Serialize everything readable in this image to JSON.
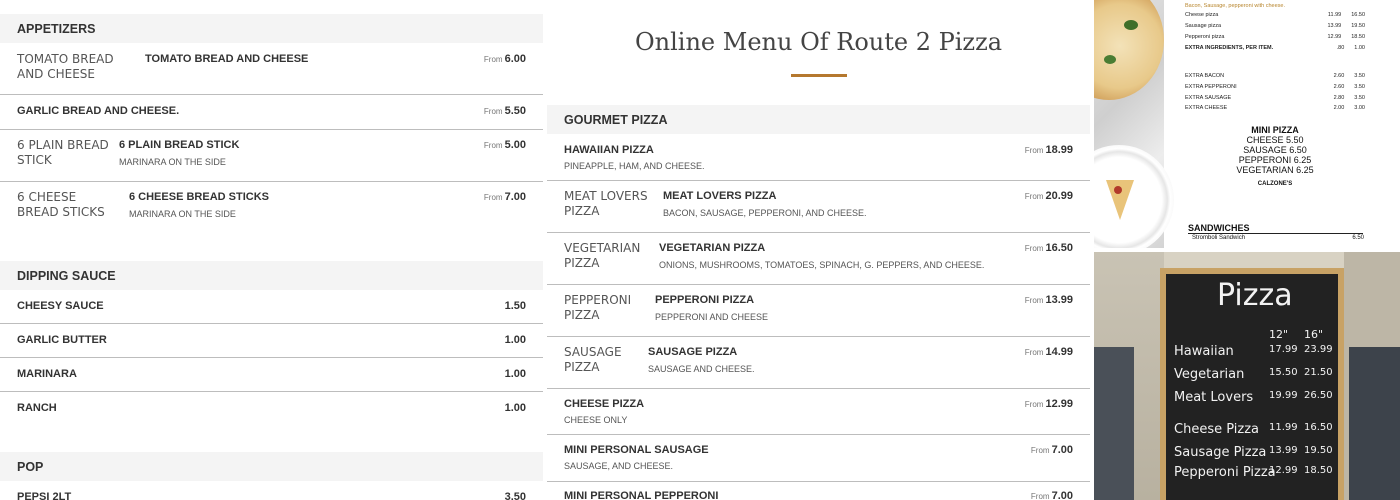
{
  "left": {
    "appetizers": {
      "title": "APPETIZERS",
      "items": [
        {
          "img_alt": "TOMATO BREAD AND CHEESE",
          "name": "TOMATO BREAD AND CHEESE",
          "desc": "",
          "from": "From",
          "price": "6.00"
        },
        {
          "img_alt": "",
          "name": "GARLIC BREAD AND CHEESE.",
          "desc": "",
          "from": "From",
          "price": "5.50"
        },
        {
          "img_alt": "6 PLAIN BREAD STICK",
          "name": "6 PLAIN BREAD STICK",
          "desc": "MARINARA ON THE SIDE",
          "from": "From",
          "price": "5.00"
        },
        {
          "img_alt": "6 CHEESE BREAD STICKS",
          "name": "6 CHEESE BREAD STICKS",
          "desc": "MARINARA ON THE SIDE",
          "from": "From",
          "price": "7.00"
        }
      ]
    },
    "dipping": {
      "title": "DIPPING SAUCE",
      "items": [
        {
          "name": "CHEESY SAUCE",
          "price": "1.50"
        },
        {
          "name": "GARLIC BUTTER",
          "price": "1.00"
        },
        {
          "name": "MARINARA",
          "price": "1.00"
        },
        {
          "name": "RANCH",
          "price": "1.00"
        }
      ]
    },
    "pop": {
      "title": "POP",
      "items": [
        {
          "name": "PEPSI 2LT",
          "price": "3.50"
        }
      ]
    }
  },
  "middle": {
    "page_title": "Online Menu Of Route 2 Pizza",
    "accent_color": "#b5782e",
    "gourmet": {
      "title": "GOURMET PIZZA",
      "items": [
        {
          "img_alt": "",
          "name": "HAWAIIAN PIZZA",
          "desc": "PINEAPPLE, HAM, AND CHEESE.",
          "from": "From",
          "price": "18.99"
        },
        {
          "img_alt": "MEAT LOVERS PIZZA",
          "name": "MEAT LOVERS PIZZA",
          "desc": "BACON, SAUSAGE, PEPPERONI, AND CHEESE.",
          "from": "From",
          "price": "20.99"
        },
        {
          "img_alt": "VEGETARIAN PIZZA",
          "name": "VEGETARIAN PIZZA",
          "desc": "ONIONS, MUSHROOMS, TOMATOES, SPINACH, G. PEPPERS, AND CHEESE.",
          "from": "From",
          "price": "16.50"
        },
        {
          "img_alt": "PEPPERONI PIZZA",
          "name": "PEPPERONI PIZZA",
          "desc": "PEPPERONI AND CHEESE",
          "from": "From",
          "price": "13.99"
        },
        {
          "img_alt": "SAUSAGE PIZZA",
          "name": "SAUSAGE PIZZA",
          "desc": "SAUSAGE AND CHEESE.",
          "from": "From",
          "price": "14.99"
        },
        {
          "img_alt": "",
          "name": "CHEESE PIZZA",
          "desc": "CHEESE ONLY",
          "from": "From",
          "price": "12.99"
        },
        {
          "img_alt": "",
          "name": "MINI PERSONAL SAUSAGE",
          "desc": "SAUSAGE, AND CHEESE.",
          "from": "From",
          "price": "7.00"
        },
        {
          "img_alt": "",
          "name": "MINI PERSONAL PEPPERONI",
          "desc": "",
          "from": "From",
          "price": "7.00"
        }
      ]
    }
  },
  "right": {
    "menu_photo": {
      "lines": [
        {
          "name": "Bacon, Sausage, pepperoni with cheese.",
          "p1": "",
          "p2": ""
        },
        {
          "name": "Cheese pizza",
          "p1": "11.99",
          "p2": "16.50"
        },
        {
          "name": "Sausage pizza",
          "p1": "13.99",
          "p2": "19.50"
        },
        {
          "name": "Pepperoni pizza",
          "p1": "12.99",
          "p2": "18.50"
        },
        {
          "name": "EXTRA INGREDIENTS, PER ITEM.",
          "p1": ".80",
          "p2": "1.00"
        },
        {
          "name": "EXTRA BACON",
          "p1": "2.60",
          "p2": "3.50"
        },
        {
          "name": "EXTRA PEPPERONI",
          "p1": "2.60",
          "p2": "3.50"
        },
        {
          "name": "EXTRA SAUSAGE",
          "p1": "2.80",
          "p2": "3.50"
        },
        {
          "name": "EXTRA CHEESE",
          "p1": "2.00",
          "p2": "3.00"
        }
      ],
      "mini_title": "MINI PIZZA",
      "mini_lines": [
        "CHEESE 5.50",
        "SAUSAGE 6.50",
        "PEPPERONI 6.25",
        "VEGETARIAN 6.25"
      ],
      "calzone": "CALZONE'S",
      "sandwiches": "SANDWICHES",
      "stromboli": "Stromboli Sandwich",
      "stromboli_price": "6.50"
    },
    "board_photo": {
      "title": "Pizza",
      "sizes": [
        "12\"",
        "16\""
      ],
      "rows": [
        {
          "name": "Hawaiian",
          "p1": "17.99",
          "p2": "23.99"
        },
        {
          "name": "Vegetarian",
          "p1": "15.50",
          "p2": "21.50"
        },
        {
          "name": "Meat Lovers",
          "p1": "19.99",
          "p2": "26.50"
        },
        {
          "name": "Cheese Pizza",
          "p1": "11.99",
          "p2": "16.50"
        },
        {
          "name": "Sausage Pizza",
          "p1": "13.99",
          "p2": "19.50"
        },
        {
          "name": "Pepperoni Pizza",
          "p1": "12.99",
          "p2": "18.50"
        }
      ]
    }
  }
}
